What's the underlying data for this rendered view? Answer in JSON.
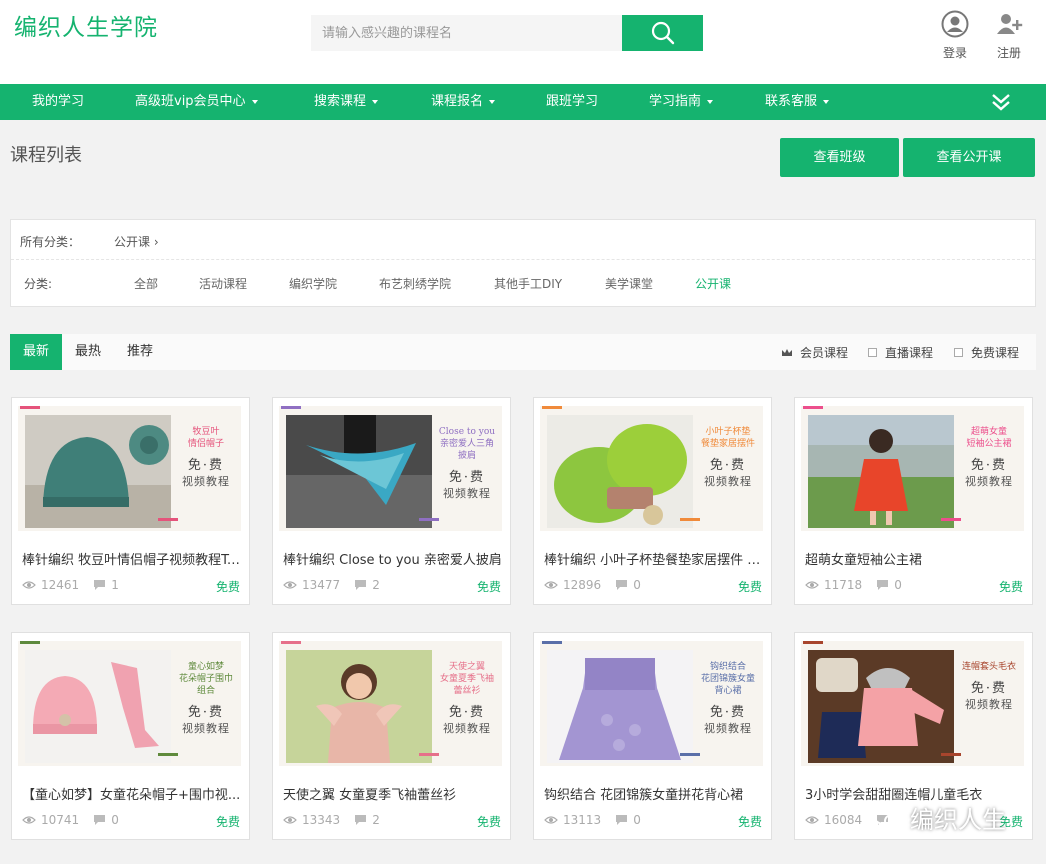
{
  "header": {
    "logo": "编织人生学院",
    "search_placeholder": "请输入感兴趣的课程名",
    "login": "登录",
    "register": "注册"
  },
  "nav": [
    {
      "label": "我的学习",
      "dropdown": false
    },
    {
      "label": "高级班vip会员中心",
      "dropdown": true
    },
    {
      "label": "搜索课程",
      "dropdown": true
    },
    {
      "label": "课程报名",
      "dropdown": true
    },
    {
      "label": "跟班学习",
      "dropdown": false
    },
    {
      "label": "学习指南",
      "dropdown": true
    },
    {
      "label": "联系客服",
      "dropdown": true
    }
  ],
  "page": {
    "title": "课程列表",
    "btn_class": "查看班级",
    "btn_open": "查看公开课"
  },
  "filter": {
    "all_label": "所有分类：",
    "crumb": "公开课 ›",
    "cat_label": "分类:",
    "categories": [
      "全部",
      "活动课程",
      "编织学院",
      "布艺刺绣学院",
      "其他手工DIY",
      "美学课堂",
      "公开课"
    ],
    "active": "公开课"
  },
  "tabs": [
    "最新",
    "最热",
    "推荐"
  ],
  "options": {
    "member": "会员课程",
    "live": "直播课程",
    "free": "免费课程"
  },
  "banner_common": {
    "free": "免·费",
    "video": "视频教程"
  },
  "courses": [
    {
      "title": "棒针编织 牧豆叶情侣帽子视频教程Ta...",
      "views": "12461",
      "comments": "1",
      "price": "免费",
      "banner_lines": [
        "牧豆叶",
        "情侣帽子"
      ],
      "accent": "#e5537b",
      "theme": "hat"
    },
    {
      "title": "棒针编织 Close to you 亲密爱人披肩",
      "views": "13477",
      "comments": "2",
      "price": "免费",
      "banner_lines": [
        "Close to you",
        "亲密爱人三角披肩"
      ],
      "accent": "#8f6fc2",
      "theme": "shawl"
    },
    {
      "title": "棒针编织 小叶子杯垫餐垫家居摆件 毛...",
      "views": "12896",
      "comments": "0",
      "price": "免费",
      "banner_lines": [
        "小叶子杯垫",
        "餐垫家居摆件"
      ],
      "accent": "#f08a3a",
      "theme": "leaf"
    },
    {
      "title": "超萌女童短袖公主裙",
      "views": "11718",
      "comments": "0",
      "price": "免费",
      "banner_lines": [
        "超萌女童",
        "短袖公主裙"
      ],
      "accent": "#ec4f8c",
      "theme": "dress-red"
    },
    {
      "title": "【童心如梦】女童花朵帽子+围巾视...",
      "views": "10741",
      "comments": "0",
      "price": "免费",
      "banner_lines": [
        "童心如梦",
        "花朵帽子围巾组合"
      ],
      "accent": "#5f8a3c",
      "theme": "pink-set"
    },
    {
      "title": "天使之翼 女童夏季飞袖蕾丝衫",
      "views": "13343",
      "comments": "2",
      "price": "免费",
      "banner_lines": [
        "天使之翼",
        "女童夏季飞袖蕾丝衫"
      ],
      "accent": "#e6708a",
      "theme": "angel"
    },
    {
      "title": "钩织结合 花团锦簇女童拼花背心裙",
      "views": "13113",
      "comments": "0",
      "price": "免费",
      "banner_lines": [
        "钩织结合",
        "花团锦簇女童背心裙"
      ],
      "accent": "#5a6fa8",
      "theme": "purple"
    },
    {
      "title": "3小时学会甜甜圈连帽儿童毛衣",
      "views": "16084",
      "comments": "",
      "price": "免费",
      "banner_lines": [
        "连帽套头毛衣",
        ""
      ],
      "accent": "#a8452d",
      "theme": "hoodie"
    }
  ],
  "watermark": "编织人生"
}
